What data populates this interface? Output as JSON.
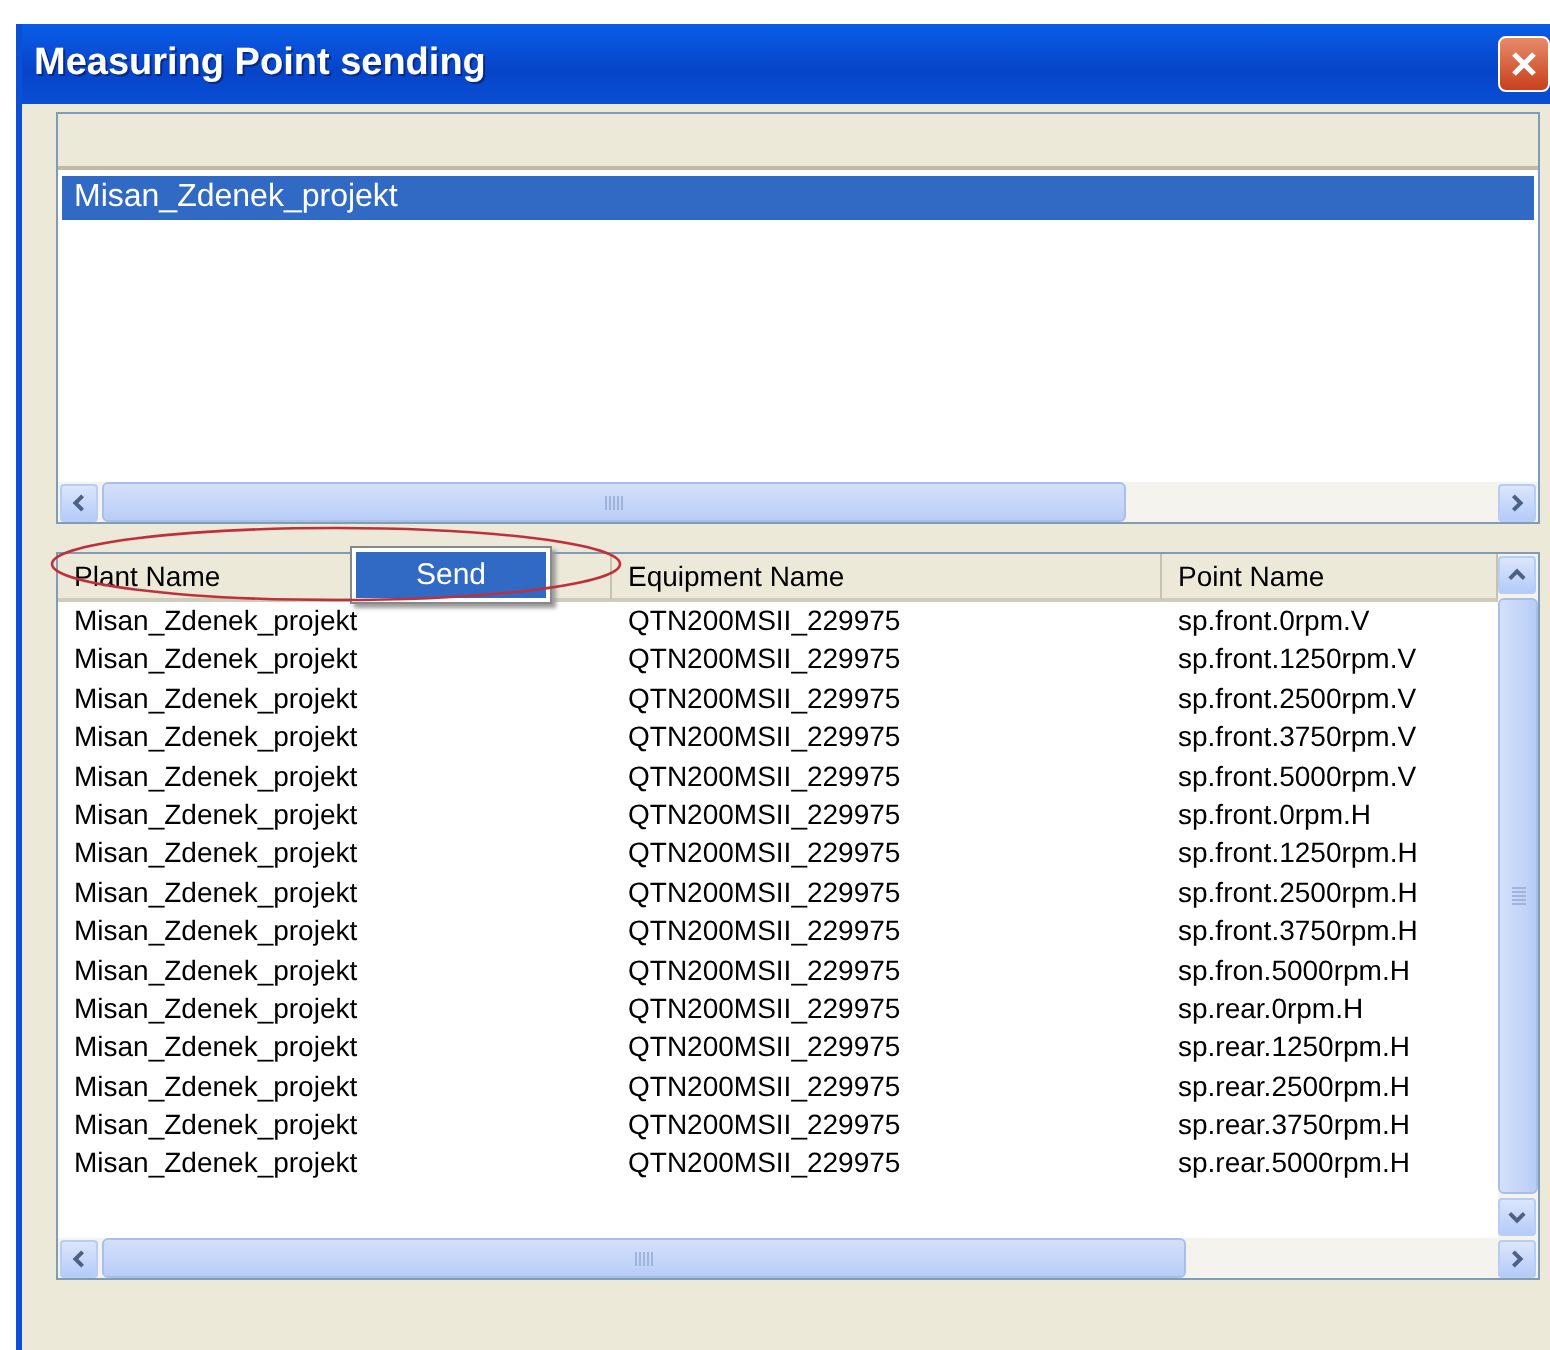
{
  "window": {
    "title": "Measuring Point sending"
  },
  "plant_list": {
    "items": [
      {
        "label": "Misan_Zdenek_projekt",
        "selected": true
      }
    ]
  },
  "point_table": {
    "columns": [
      "Plant Name",
      "Equipment Name",
      "Point Name"
    ],
    "rows": [
      [
        "Misan_Zdenek_projekt",
        "QTN200MSII_229975",
        "sp.front.0rpm.V"
      ],
      [
        "Misan_Zdenek_projekt",
        "QTN200MSII_229975",
        "sp.front.1250rpm.V"
      ],
      [
        "Misan_Zdenek_projekt",
        "QTN200MSII_229975",
        "sp.front.2500rpm.V"
      ],
      [
        "Misan_Zdenek_projekt",
        "QTN200MSII_229975",
        "sp.front.3750rpm.V"
      ],
      [
        "Misan_Zdenek_projekt",
        "QTN200MSII_229975",
        "sp.front.5000rpm.V"
      ],
      [
        "Misan_Zdenek_projekt",
        "QTN200MSII_229975",
        "sp.front.0rpm.H"
      ],
      [
        "Misan_Zdenek_projekt",
        "QTN200MSII_229975",
        "sp.front.1250rpm.H"
      ],
      [
        "Misan_Zdenek_projekt",
        "QTN200MSII_229975",
        "sp.front.2500rpm.H"
      ],
      [
        "Misan_Zdenek_projekt",
        "QTN200MSII_229975",
        "sp.front.3750rpm.H"
      ],
      [
        "Misan_Zdenek_projekt",
        "QTN200MSII_229975",
        "sp.fron.5000rpm.H"
      ],
      [
        "Misan_Zdenek_projekt",
        "QTN200MSII_229975",
        "sp.rear.0rpm.H"
      ],
      [
        "Misan_Zdenek_projekt",
        "QTN200MSII_229975",
        "sp.rear.1250rpm.H"
      ],
      [
        "Misan_Zdenek_projekt",
        "QTN200MSII_229975",
        "sp.rear.2500rpm.H"
      ],
      [
        "Misan_Zdenek_projekt",
        "QTN200MSII_229975",
        "sp.rear.3750rpm.H"
      ],
      [
        "Misan_Zdenek_projekt",
        "QTN200MSII_229975",
        "sp.rear.5000rpm.H"
      ]
    ]
  },
  "context_menu": {
    "items": [
      "Send"
    ]
  }
}
